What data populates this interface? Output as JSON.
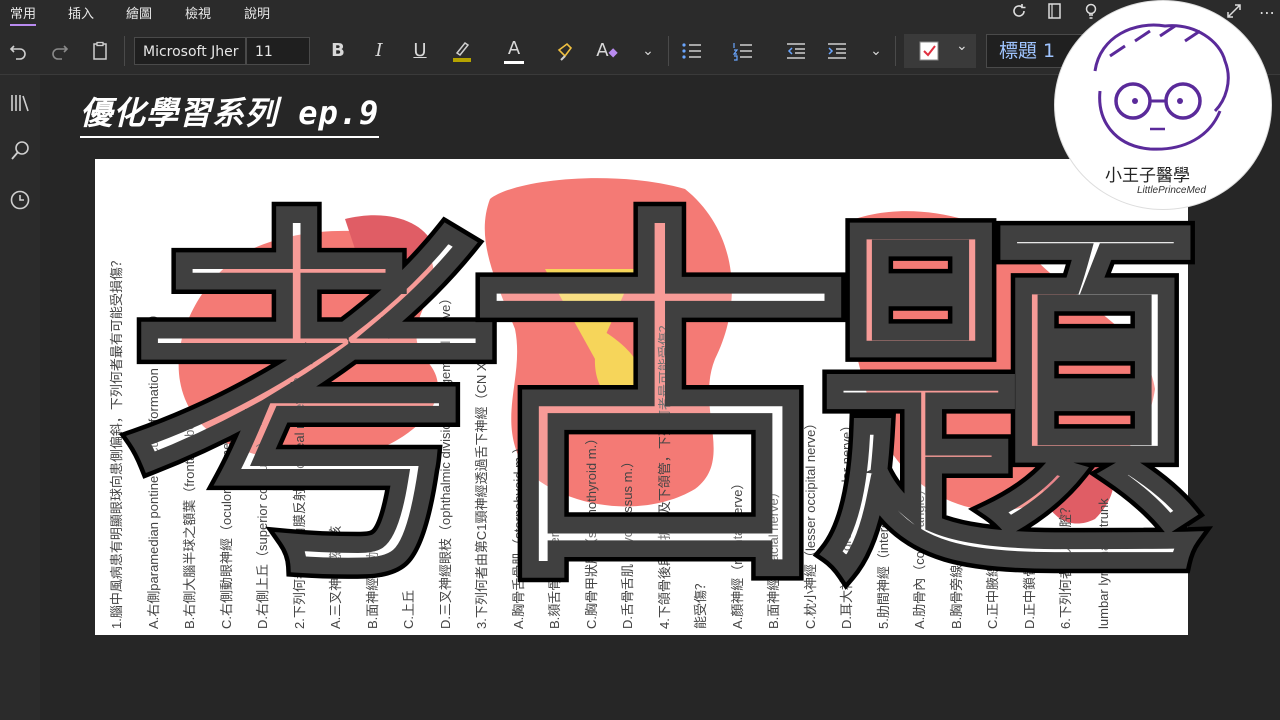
{
  "menu": {
    "tabs": [
      "常用",
      "插入",
      "繪圖",
      "檢視",
      "說明"
    ],
    "active_tab": "常用"
  },
  "ribbon": {
    "font_name": "Microsoft Jher",
    "font_size": "11",
    "bold": "B",
    "italic": "I",
    "underline": "U",
    "font_color_glyph": "A",
    "style_glyph": "A",
    "style_name": "標題 1"
  },
  "page": {
    "title": "優化學習系列 ep.9",
    "big_title": [
      "考",
      "古",
      "題"
    ]
  },
  "exam_sheet": {
    "lines": [
      "1.腦中風病患有明顯眼球向患側偏斜，下列何者最有可能受損傷？",
      "A.右側paramedian pontine reticular formation（PPRF）",
      "B.右側大腦半球之額葉（frontal lobe）",
      "C.右側動眼神經（oculomotor nerve）",
      "D.右側上丘（superior colliculus）",
      "2.下列何者不是角膜反射（corneal reflex）？",
      "A.三叉神經感覺核",
      "B.面神經運動核",
      "C.上丘",
      "D.三叉神經眼枝（ophthalmic division of trigeminal nerve）",
      "3.下列何者由第C1頸神經透過舌下神經（CN XII）來支配？",
      "A.胸骨舌骨肌（sternohyoid m.）",
      "B.頦舌骨肌（geniohyoid m.）",
      "C.胸骨甲狀肌（sternothyroid m.）",
      "D.舌骨舌肌（hyoglossus m.）",
      "4.下頜骨後段骨折傷及下頜管，下列何者最可能受傷？",
      "能受傷？",
      "A.顏神經（mental nerve）",
      "B.面神經（facial nerve）",
      "C.枕小神經（lesser occipital nerve）",
      "D.耳大神經（great auricular nerve）",
      "5.肋間神經（intercostal nerve）",
      "A.肋骨內（costal angle）",
      "B.胸骨旁線",
      "C.正中腋線",
      "D.正中鎖骨線",
      "6.下列何者進入胸腔？",
      "lumbar lymphatic trunk"
    ]
  },
  "watermark": {
    "name": "小王子醫學",
    "sub": "LittlePrinceMed"
  },
  "colors": {
    "accent": "#b98bf0",
    "blob": "#f47a75",
    "blob_dark": "#e05d65",
    "blob_yellow": "#f6d55a",
    "style_text": "#9fc4ff"
  }
}
